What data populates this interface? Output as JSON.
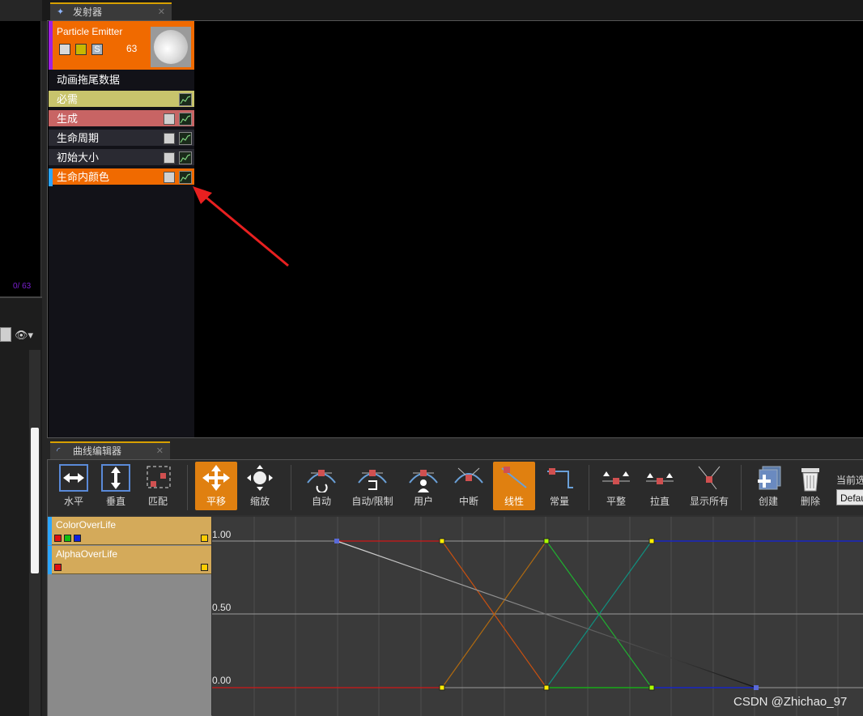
{
  "left_viewport": {
    "count_text": "0/ 63"
  },
  "emitter_tab": {
    "title": "发射器"
  },
  "emitter": {
    "name": "Particle Emitter",
    "count": "63",
    "solo_label": "S"
  },
  "modules": [
    {
      "label": "动画拖尾数据"
    },
    {
      "label": "必需"
    },
    {
      "label": "生成"
    },
    {
      "label": "生命周期"
    },
    {
      "label": "初始大小"
    },
    {
      "label": "生命内颜色"
    }
  ],
  "curve_tab": {
    "title": "曲线编辑器"
  },
  "toolbar": {
    "buttons": [
      {
        "label": "水平",
        "icon": "fit-horizontal-icon"
      },
      {
        "label": "垂直",
        "icon": "fit-vertical-icon"
      },
      {
        "label": "匹配",
        "icon": "fit-selected-icon"
      },
      {
        "label": "平移",
        "icon": "pan-icon",
        "active": true
      },
      {
        "label": "缩放",
        "icon": "zoom-icon"
      },
      {
        "label": "自动",
        "icon": "auto-tangent-icon"
      },
      {
        "label": "自动/限制",
        "icon": "auto-clamped-icon"
      },
      {
        "label": "用户",
        "icon": "user-tangent-icon"
      },
      {
        "label": "中断",
        "icon": "break-tangent-icon"
      },
      {
        "label": "线性",
        "icon": "linear-icon",
        "active": true
      },
      {
        "label": "常量",
        "icon": "constant-icon"
      },
      {
        "label": "平整",
        "icon": "flatten-icon"
      },
      {
        "label": "拉直",
        "icon": "straighten-icon"
      },
      {
        "label": "显示所有",
        "icon": "show-all-tangents-icon"
      },
      {
        "label": "创建",
        "icon": "create-tab-icon"
      },
      {
        "label": "删除",
        "icon": "delete-tab-icon"
      }
    ],
    "current_label": "当前选",
    "preset_value": "Defau"
  },
  "curves": [
    {
      "name": "ColorOverLife",
      "channels": [
        "#e01010",
        "#10c010",
        "#1020e0"
      ]
    },
    {
      "name": "AlphaOverLife",
      "channels": [
        "#e01010"
      ]
    }
  ],
  "graph": {
    "y_labels": [
      "1.00",
      "0.50",
      "0.00"
    ]
  },
  "colors": {
    "accent_orange": "#f06a00",
    "active_button": "#e08010",
    "curve_red": "#e01010",
    "curve_green": "#10c010",
    "curve_blue": "#1020e0",
    "arrow_red": "#e82020"
  },
  "watermark": "CSDN @Zhichao_97"
}
